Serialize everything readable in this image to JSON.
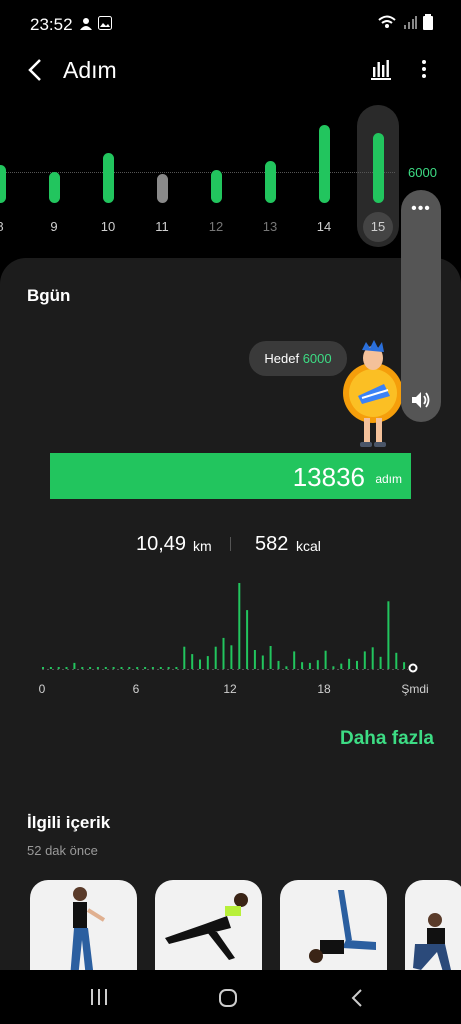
{
  "status": {
    "time": "23:52"
  },
  "header": {
    "title": "Adım"
  },
  "week": {
    "goal_label": "6000",
    "days": [
      {
        "label": "8",
        "value": 5200,
        "color": "green"
      },
      {
        "label": "9",
        "value": 4300,
        "color": "green"
      },
      {
        "label": "10",
        "value": 6800,
        "color": "green"
      },
      {
        "label": "11",
        "value": 4000,
        "color": "gray"
      },
      {
        "label": "12",
        "value": 4500,
        "color": "green"
      },
      {
        "label": "13",
        "value": 5800,
        "color": "green"
      },
      {
        "label": "14",
        "value": 10700,
        "color": "green"
      },
      {
        "label": "15",
        "value": 9600,
        "color": "green"
      }
    ]
  },
  "volume": {
    "dots": "•••"
  },
  "today": {
    "title": "Bgün",
    "goal_prefix": "Hedef",
    "goal_value": "6000",
    "steps": "13836",
    "steps_unit": "adım",
    "distance": "10,49",
    "distance_unit": "km",
    "calories": "582",
    "calories_unit": "kcal",
    "hour_labels": [
      "0",
      "6",
      "12",
      "18",
      "Şmdi"
    ],
    "more": "Daha fazla"
  },
  "chart_data": {
    "type": "bar",
    "x": [
      0,
      0.5,
      1,
      1.5,
      2,
      2.5,
      3,
      3.5,
      4,
      4.5,
      5,
      5.5,
      6,
      6.5,
      7,
      7.5,
      8,
      8.5,
      9,
      9.5,
      10,
      10.5,
      11,
      11.5,
      12,
      12.5,
      13,
      13.5,
      14,
      14.5,
      15,
      15.5,
      16,
      16.5,
      17,
      17.5,
      18,
      18.5,
      19,
      19.5,
      20,
      20.5,
      21,
      21.5,
      22,
      22.5,
      23
    ],
    "values": [
      30,
      30,
      30,
      30,
      90,
      30,
      30,
      30,
      30,
      30,
      30,
      30,
      30,
      30,
      30,
      30,
      30,
      30,
      330,
      220,
      140,
      190,
      330,
      460,
      350,
      1270,
      870,
      280,
      200,
      340,
      120,
      40,
      260,
      100,
      90,
      130,
      270,
      40,
      80,
      150,
      120,
      260,
      320,
      180,
      1000,
      240,
      100
    ],
    "xlabel": "",
    "ylabel": "",
    "ticks": [
      "0",
      "6",
      "12",
      "18",
      "Şmdi"
    ]
  },
  "related": {
    "title": "İlgili içerik",
    "time": "52 dak önce"
  },
  "colors": {
    "accent": "#22c55e",
    "accent_text": "#3ddc84",
    "card": "#1c1c1c"
  }
}
